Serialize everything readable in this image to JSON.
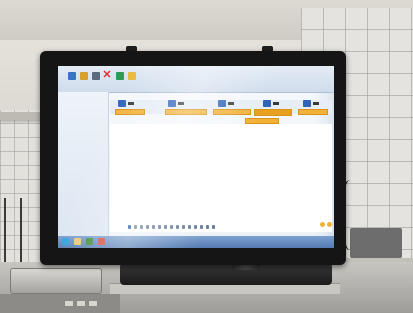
{
  "scene": {
    "description_label": "",
    "colors": {
      "bezel": "#151515",
      "screen": "#f4f7fb",
      "accent_orange": "#f2b23a",
      "accent_blue": "#2e63b8",
      "taskbar": "#3e6aa8"
    }
  },
  "monitor": {
    "app": {
      "title": "",
      "toolbar": {
        "icons": [
          "save-icon",
          "open-icon",
          "print-icon",
          "close-icon",
          "help-icon",
          "info-icon"
        ],
        "close_glyph": "✕"
      },
      "side_panel": {
        "items": [
          "",
          ""
        ]
      },
      "columns": [
        {
          "name": ""
        },
        {
          "name": ""
        },
        {
          "name": ""
        },
        {
          "name": ""
        },
        {
          "name": ""
        }
      ],
      "pagination": {
        "pages": 15,
        "active_page": 1
      },
      "footer_status": ""
    },
    "taskbar": {
      "icons": [
        "start-icon",
        "explorer-icon",
        "app-icon",
        "tool-icon"
      ]
    }
  }
}
